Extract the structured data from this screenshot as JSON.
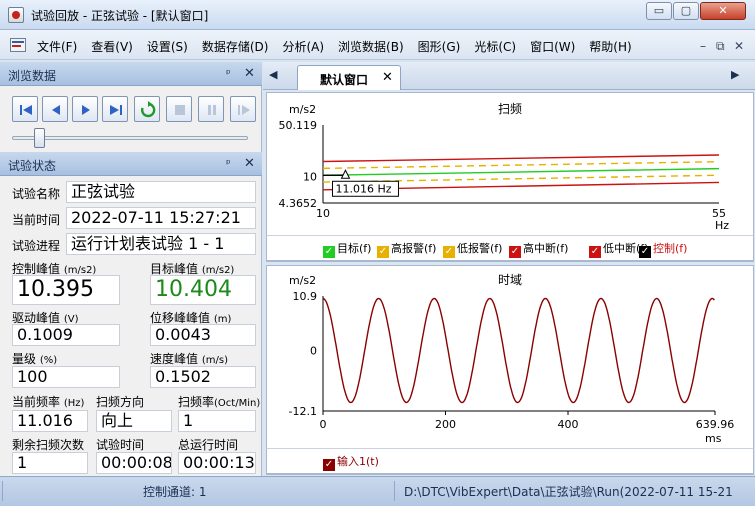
{
  "window": {
    "title": "试验回放 - 正弦试验 - [默认窗口]",
    "min_glyph": "▭",
    "max_glyph": "▢",
    "close_glyph": "✕"
  },
  "menu": {
    "items": [
      "文件(F)",
      "查看(V)",
      "设置(S)",
      "数据存储(D)",
      "分析(A)",
      "浏览数据(B)",
      "图形(G)",
      "光标(C)",
      "窗口(W)",
      "帮助(H)"
    ],
    "mdi_min": "–",
    "mdi_restore": "⧉",
    "mdi_close": "✕"
  },
  "browse_panel": {
    "title": "浏览数据",
    "pin": "ᵖ",
    "close": "✕",
    "playback_buttons": [
      "first",
      "prev",
      "play",
      "last",
      "refresh",
      "stop",
      "pause",
      "step"
    ],
    "slider_position": 0.12
  },
  "status_panel": {
    "title": "试验状态",
    "pin": "ᵖ",
    "close": "✕",
    "test_name_label": "试验名称",
    "test_name": "正弦试验",
    "current_time_label": "当前时间",
    "current_time": "2022-07-11 15:27:21",
    "progress_label": "试验进程",
    "progress": "运行计划表试验 1 - 1",
    "control_peak_label": "控制峰值",
    "control_peak_unit": "(m/s2)",
    "control_peak": "10.395",
    "target_peak_label": "目标峰值",
    "target_peak_unit": "(m/s2)",
    "target_peak": "10.404",
    "drive_peak_label": "驱动峰值",
    "drive_peak_unit": "(V)",
    "drive_peak": "0.1009",
    "disp_peak_label": "位移峰峰值",
    "disp_peak_unit": "(m)",
    "disp_peak": "0.0043",
    "level_label": "量级",
    "level_unit": "(%)",
    "level": "100",
    "vel_peak_label": "速度峰值",
    "vel_peak_unit": "(m/s)",
    "vel_peak": "0.1502",
    "freq_label": "当前频率",
    "freq_unit": "(Hz)",
    "freq": "11.016",
    "dir_label": "扫频方向",
    "dir": "向上",
    "rate_label": "扫频率",
    "rate_unit": "(Oct/Min)",
    "rate": "1",
    "remain_label": "剩余扫频次数",
    "remain": "1",
    "test_time_label": "试验时间",
    "test_time": "00:00:08",
    "total_time_label": "总运行时间",
    "total_time": "00:00:13"
  },
  "tab": {
    "label": "默认窗口",
    "close": "✕",
    "nav_left": "◀",
    "nav_right": "▶"
  },
  "chart_data": [
    {
      "type": "line",
      "title": "扫频",
      "ylabel": "m/s2",
      "xlabel": "Hz",
      "x_ticks": [
        "10",
        "55"
      ],
      "y_ticks": [
        "50.119",
        "10",
        "4.3652"
      ],
      "xlim": [
        10,
        55
      ],
      "ylim": [
        4.3652,
        50.119
      ],
      "cursor_label": "11.016 Hz",
      "cursor_x": 11.016,
      "series": [
        {
          "name": "目标(f)",
          "color": "#22cc22",
          "style": "solid",
          "x": [
            10,
            55
          ],
          "y": [
            10.4,
            12.8
          ]
        },
        {
          "name": "高报警(f)",
          "color": "#e8b000",
          "style": "dashed",
          "x": [
            10,
            55
          ],
          "y": [
            12.9,
            15.9
          ]
        },
        {
          "name": "低报警(f)",
          "color": "#e8b000",
          "style": "dashed",
          "x": [
            10,
            55
          ],
          "y": [
            8.4,
            10.4
          ]
        },
        {
          "name": "高中断(f)",
          "color": "#cc1111",
          "style": "solid",
          "x": [
            10,
            55
          ],
          "y": [
            16.0,
            19.6
          ]
        },
        {
          "name": "低中断(f)",
          "color": "#cc1111",
          "style": "solid",
          "x": [
            10,
            55
          ],
          "y": [
            6.6,
            8.3
          ]
        },
        {
          "name": "控制(f)",
          "color": "#000000",
          "style": "solid",
          "x": [
            10,
            11.016
          ],
          "y": [
            10.395,
            10.395
          ]
        }
      ]
    },
    {
      "type": "line",
      "title": "时域",
      "ylabel": "m/s2",
      "xlabel": "ms",
      "x_ticks": [
        "0",
        "200",
        "400",
        "639.96"
      ],
      "y_ticks": [
        "10.9",
        "0",
        "-12.1"
      ],
      "xlim": [
        0,
        639.96
      ],
      "ylim": [
        -12.1,
        10.9
      ],
      "series": [
        {
          "name": "输入1(t)",
          "color": "#8b0000",
          "amplitude": 10.4,
          "period_ms": 90.78
        }
      ]
    }
  ],
  "statusbar": {
    "channel": "控制通道: 1",
    "path": "D:\\DTC\\VibExpert\\Data\\正弦试验\\Run(2022-07-11 15-21"
  }
}
